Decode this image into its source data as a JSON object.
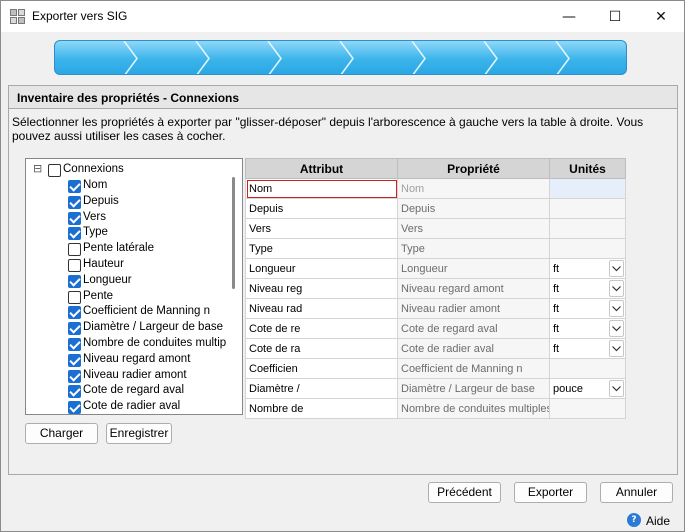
{
  "window": {
    "title": "Exporter vers SIG",
    "minimize_glyph": "—",
    "maximize_glyph": "☐",
    "close_glyph": "✕"
  },
  "wizard": {
    "step_count": 8
  },
  "panel": {
    "header": "Inventaire des propriétés - Connexions",
    "instructions": "Sélectionner les propriétés à exporter par \"glisser-déposer\" depuis l'arborescence à gauche vers la table à droite. Vous pouvez aussi utiliser les cases à cocher."
  },
  "tree": {
    "root": {
      "label": "Connexions",
      "expander": "⊟",
      "checked": false
    },
    "items": [
      {
        "label": "Nom",
        "checked": true
      },
      {
        "label": "Depuis",
        "checked": true
      },
      {
        "label": "Vers",
        "checked": true
      },
      {
        "label": "Type",
        "checked": true
      },
      {
        "label": "Pente latérale",
        "checked": false
      },
      {
        "label": "Hauteur",
        "checked": false
      },
      {
        "label": "Longueur",
        "checked": true
      },
      {
        "label": "Pente",
        "checked": false
      },
      {
        "label": "Coefficient de Manning n",
        "checked": true
      },
      {
        "label": "Diamètre / Largeur de base",
        "checked": true
      },
      {
        "label": "Nombre de conduites multiples",
        "checked": true
      },
      {
        "label": "Niveau regard amont",
        "checked": true
      },
      {
        "label": "Niveau radier amont",
        "checked": true
      },
      {
        "label": "Cote de regard aval",
        "checked": true
      },
      {
        "label": "Cote de radier aval",
        "checked": true
      }
    ]
  },
  "buttons": {
    "load": "Charger",
    "save": "Enregistrer",
    "previous": "Précédent",
    "export": "Exporter",
    "cancel": "Annuler",
    "help": "Aide",
    "help_icon": "?"
  },
  "table": {
    "headers": {
      "attribute": "Attribut",
      "property": "Propriété",
      "units": "Unités"
    },
    "rows": [
      {
        "attribute": "Nom",
        "property": "Nom",
        "unit": "",
        "dropdown": false,
        "selected": true
      },
      {
        "attribute": "Depuis",
        "property": "Depuis",
        "unit": "",
        "dropdown": false
      },
      {
        "attribute": "Vers",
        "property": "Vers",
        "unit": "",
        "dropdown": false
      },
      {
        "attribute": "Type",
        "property": "Type",
        "unit": "",
        "dropdown": false
      },
      {
        "attribute": "Longueur",
        "property": "Longueur",
        "unit": "ft",
        "dropdown": true
      },
      {
        "attribute": "Niveau reg",
        "property": "Niveau regard amont",
        "unit": "ft",
        "dropdown": true
      },
      {
        "attribute": "Niveau rad",
        "property": "Niveau radier amont",
        "unit": "ft",
        "dropdown": true
      },
      {
        "attribute": "Cote de re",
        "property": "Cote de regard aval",
        "unit": "ft",
        "dropdown": true
      },
      {
        "attribute": "Cote de ra",
        "property": "Cote de radier aval",
        "unit": "ft",
        "dropdown": true
      },
      {
        "attribute": "Coefficien",
        "property": "Coefficient de Manning n",
        "unit": "",
        "dropdown": false
      },
      {
        "attribute": "Diamètre /",
        "property": "Diamètre / Largeur de base",
        "unit": "pouce",
        "dropdown": true
      },
      {
        "attribute": "Nombre de",
        "property": "Nombre de conduites multiples",
        "unit": "",
        "dropdown": false
      }
    ]
  },
  "colors": {
    "progress_fill": "#3cb4ec",
    "checkbox_checked": "#1a6fd1",
    "selection_outline": "#d02020"
  }
}
